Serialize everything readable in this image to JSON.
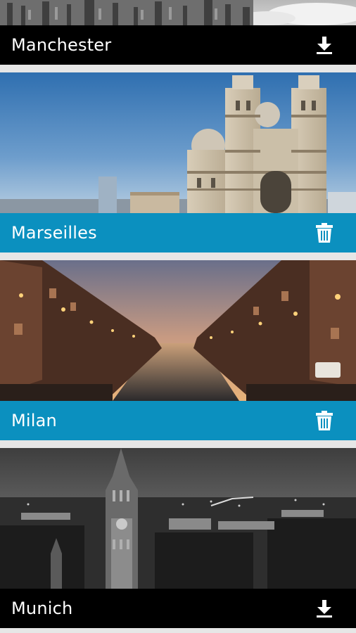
{
  "cities": [
    {
      "name": "Manchester",
      "action": "download",
      "action_icon": "download-icon",
      "bar_color": "#000000"
    },
    {
      "name": "Marseilles",
      "action": "delete",
      "action_icon": "trash-icon",
      "bar_color": "#0b90bf"
    },
    {
      "name": "Milan",
      "action": "delete",
      "action_icon": "trash-icon",
      "bar_color": "#0b90bf"
    },
    {
      "name": "Munich",
      "action": "download",
      "action_icon": "download-icon",
      "bar_color": "#000000"
    }
  ]
}
